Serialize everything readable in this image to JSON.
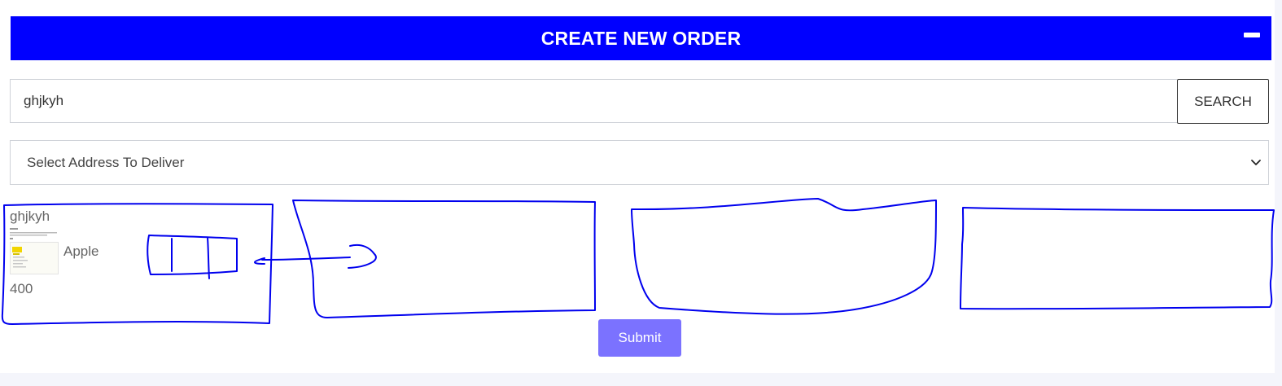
{
  "header": {
    "title": "CREATE NEW ORDER",
    "collapse_icon": "minus-icon"
  },
  "search": {
    "value": "ghjkyh",
    "button_label": "SEARCH"
  },
  "address": {
    "selected": "Select Address To Deliver",
    "icon": "chevron-down-icon"
  },
  "product": {
    "name": "ghjkyh",
    "title": "Apple",
    "price": "400"
  },
  "submit": {
    "label": "Submit"
  },
  "colors": {
    "header_bg": "#0000ff",
    "submit_bg": "#7b72ff",
    "annotation_ink": "#0000ee"
  }
}
